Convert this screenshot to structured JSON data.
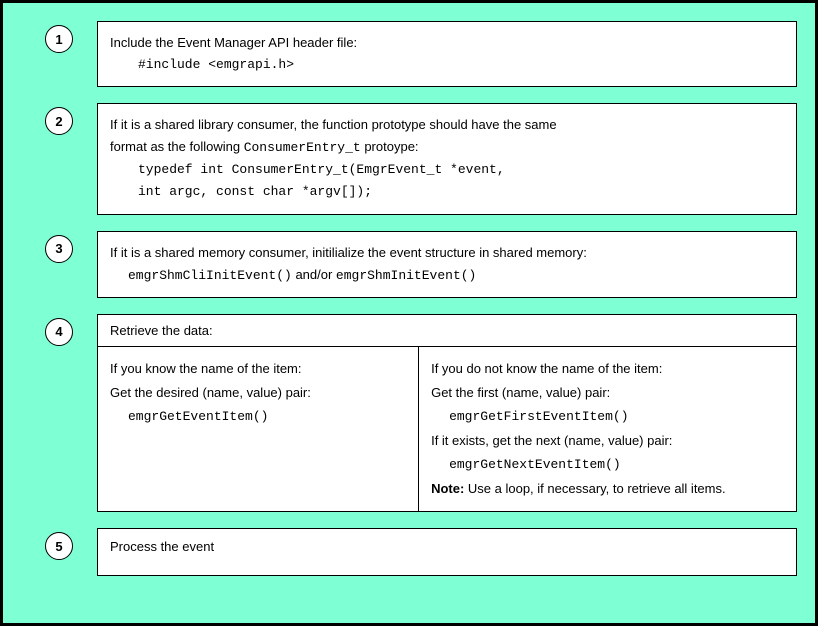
{
  "steps": {
    "s1": {
      "num": "1",
      "line1": "Include the Event Manager API header file:",
      "code1": "#include <emgrapi.h>"
    },
    "s2": {
      "num": "2",
      "line1": "If it is a shared library consumer, the function prototype should have the same",
      "line2_a": "format as the following ",
      "line2_code": "ConsumerEntry_t",
      "line2_b": " protoype:",
      "code1": "typedef int ConsumerEntry_t(EmgrEvent_t *event,",
      "code2": "int argc, const char *argv[]);"
    },
    "s3": {
      "num": "3",
      "line1": "If it is a shared memory consumer, initilialize the event structure in shared memory:",
      "code1": "emgrShmCliInitEvent()",
      "mid": " and/or ",
      "code2": "emgrShmInitEvent()"
    },
    "s4": {
      "num": "4",
      "header": "Retrieve the data:",
      "left": {
        "l1": "If you know the name of the item:",
        "l2": "Get the desired (name, value) pair:",
        "code": "emgrGetEventItem()"
      },
      "right": {
        "l1": "If you do not know the name of the item:",
        "l2": "Get the first (name, value) pair:",
        "code1": "emgrGetFirstEventItem()",
        "l3": "If it exists, get the next (name, value) pair:",
        "code2": "emgrGetNextEventItem()",
        "note_b": "Note:",
        "note_t": " Use a loop, if necessary, to retrieve all items."
      }
    },
    "s5": {
      "num": "5",
      "line1": "Process the event"
    }
  }
}
